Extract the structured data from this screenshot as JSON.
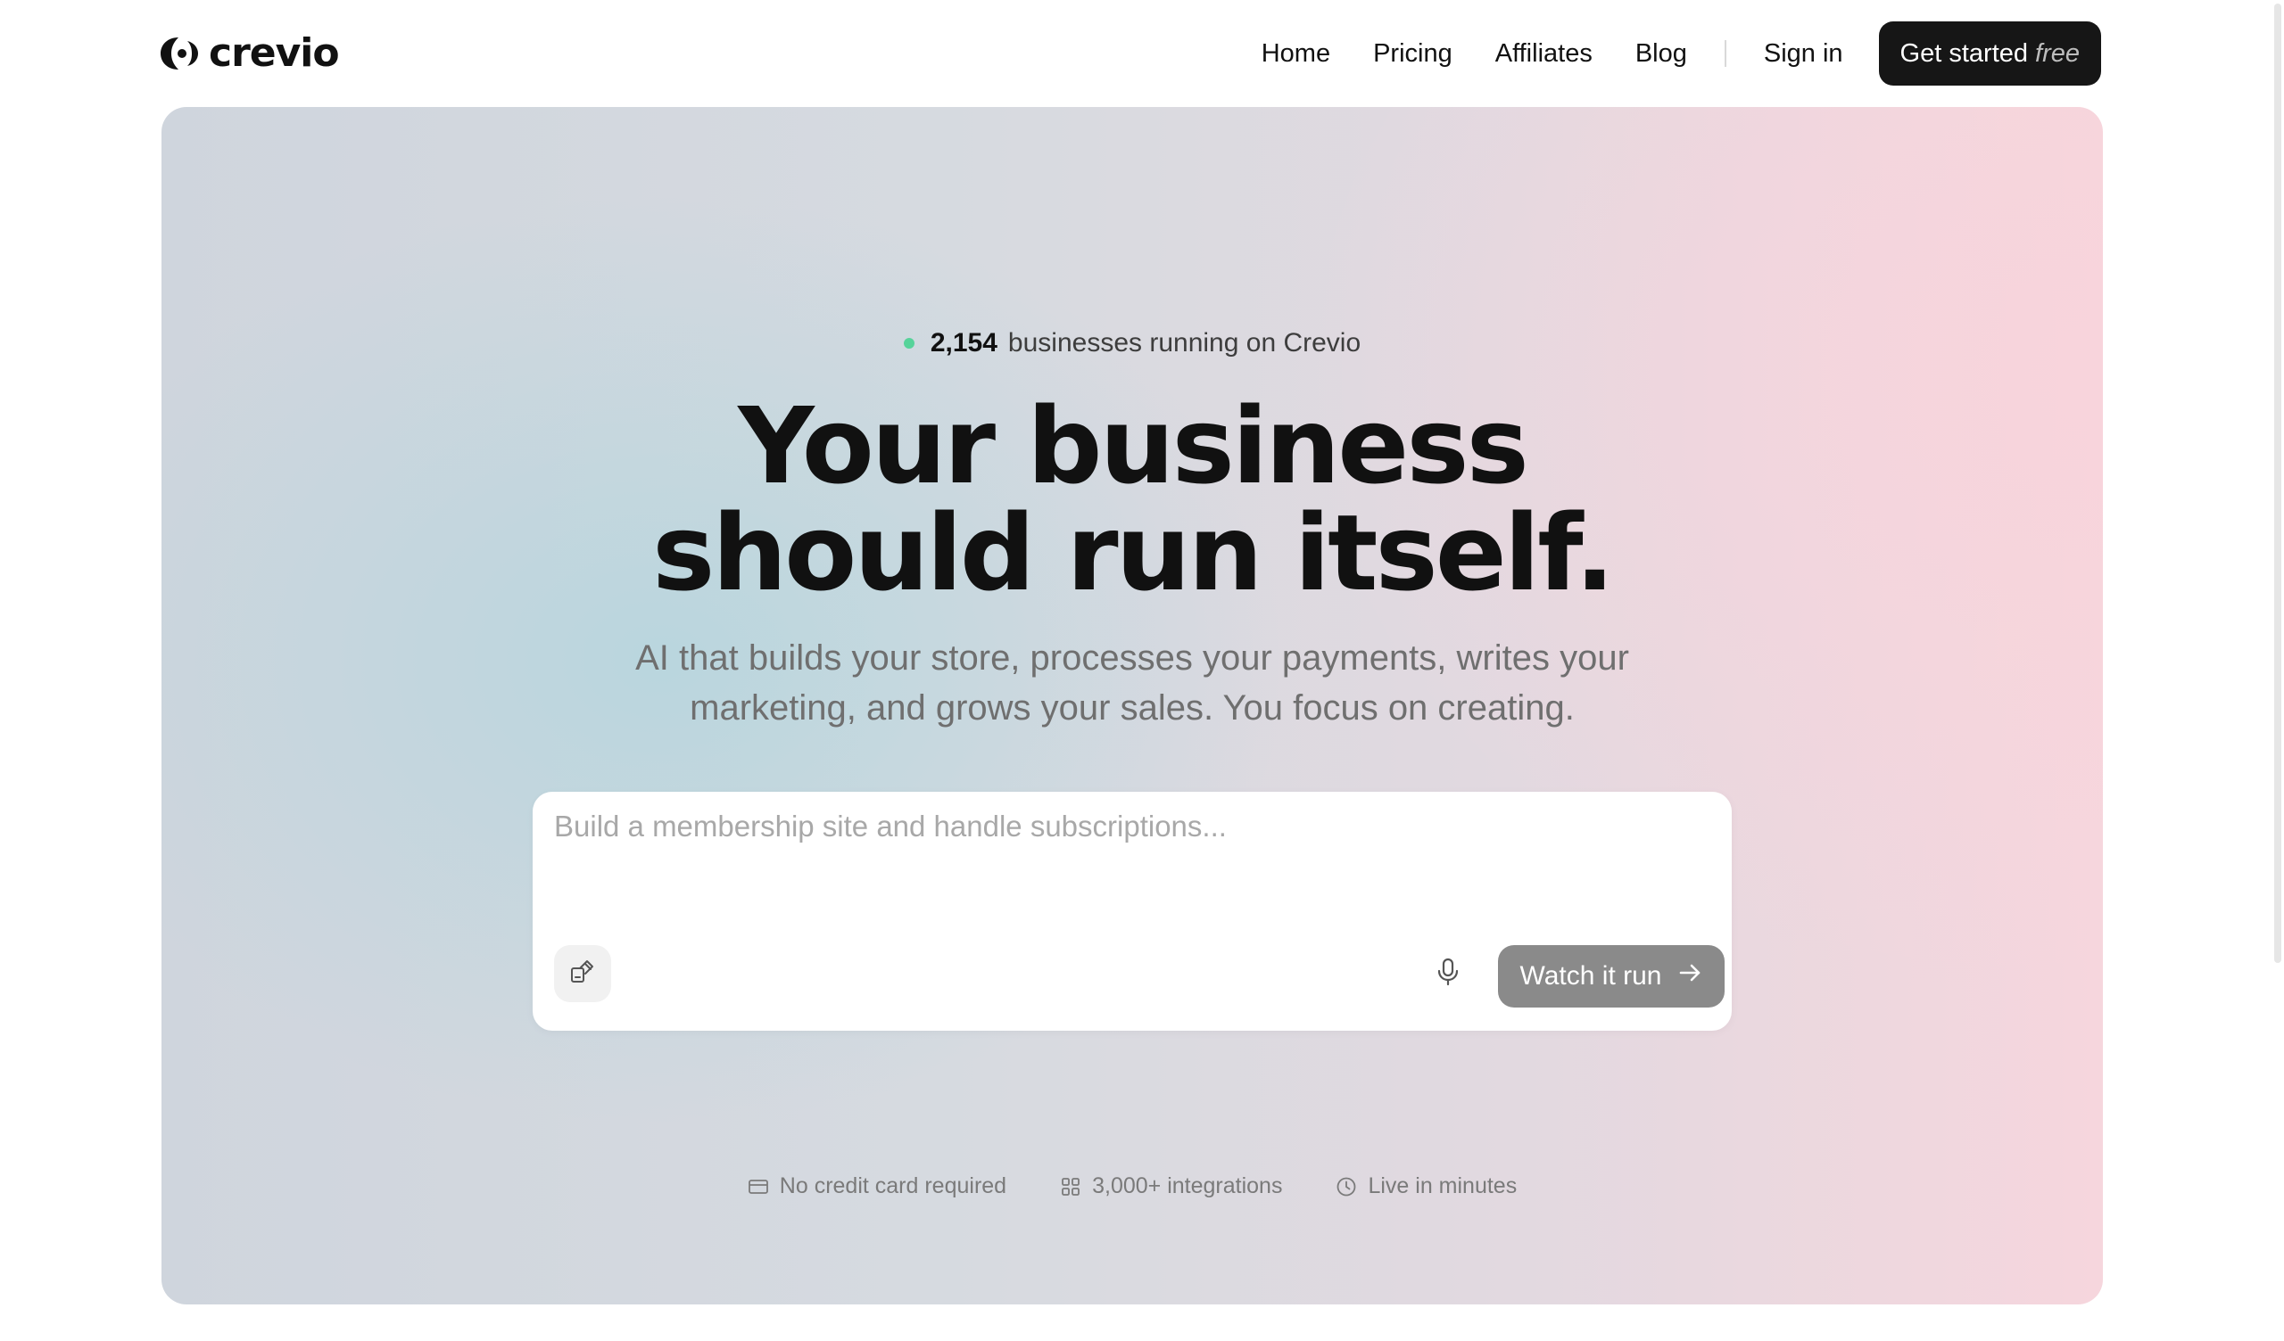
{
  "header": {
    "logo_text": "crevio",
    "nav": [
      "Home",
      "Pricing",
      "Affiliates",
      "Blog"
    ],
    "sign_in_label": "Sign in",
    "cta_label": "Get started",
    "cta_emphasis": "free"
  },
  "hero": {
    "badge": {
      "count": "2,154",
      "text": "businesses running on Crevio",
      "dot_color": "#56d39a"
    },
    "headline_line1": "Your business",
    "headline_line2": "should run itself.",
    "subhead_line1": "AI that builds your store, processes your payments, writes your",
    "subhead_line2": "marketing, and grows your sales. You focus on creating.",
    "prompt": {
      "placeholder": "Build a membership site and handle subscriptions...",
      "value": "",
      "attach_icon": "attach-icon",
      "mic_icon": "microphone-icon",
      "submit_label": "Watch it run",
      "submit_icon": "arrow-right-icon"
    },
    "features": [
      {
        "icon": "credit-card-icon",
        "label": "No credit card required"
      },
      {
        "icon": "grid-icon",
        "label": "3,000+ integrations"
      },
      {
        "icon": "clock-icon",
        "label": "Live in minutes"
      }
    ]
  },
  "colors": {
    "brand_dark": "#161616",
    "accent_green": "#56d39a",
    "button_gray": "#8a8a8a"
  }
}
